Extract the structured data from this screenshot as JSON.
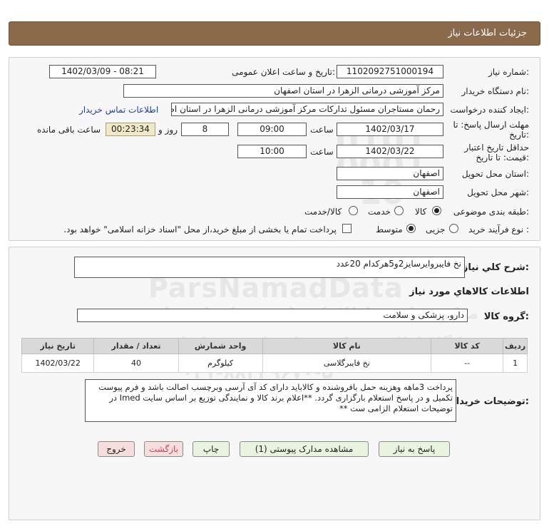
{
  "header": {
    "title": "جزئیات اطلاعات نیاز"
  },
  "form": {
    "need_number_label": "شماره نیاز:",
    "need_number": "1102092751000194",
    "announce_label": "تاریخ و ساعت اعلان عمومی:",
    "announce_value": "1402/03/09 - 08:21",
    "buyer_label": "نام دستگاه خریدار:",
    "buyer_value": "مرکز آموزشی درمانی الزهرا در استان اصفهان",
    "creator_label": "ایجاد کننده درخواست:",
    "creator_value": "رحمان مستاجران مسئول تدارکات مرکز آموزشی درمانی الزهرا در استان اصفهان",
    "contact_link": "اطلاعات تماس خریدار",
    "deadline_label_1": "مهلت ارسال پاسخ: تا",
    "deadline_label_2": "تاریخ:",
    "deadline_date": "1402/03/17",
    "time_label": "ساعت",
    "deadline_time": "09:00",
    "days_value": "8",
    "days_label": "روز و",
    "remaining_value": "00:23:34",
    "remaining_label": "ساعت باقی مانده",
    "validity_label_1": "حداقل تاریخ اعتبار",
    "validity_label_2": "قیمت: تا تاریخ:",
    "validity_date": "1402/03/22",
    "validity_time": "10:00",
    "province_label": "استان محل تحویل:",
    "province_value": "اصفهان",
    "city_label": "شهر محل تحویل:",
    "city_value": "اصفهان",
    "category_label": "طبقه بندی موضوعی:",
    "category_options": [
      "کالا",
      "خدمت",
      "کالا/خدمت"
    ],
    "category_selected": "کالا",
    "process_label": "نوع فرآیند خرید :",
    "process_options": [
      "جزیی",
      "متوسط"
    ],
    "process_selected": "متوسط",
    "payment_text": "پرداخت تمام یا بخشی از مبلغ خرید،از محل \"اسناد خزانه اسلامی\" خواهد بود."
  },
  "details": {
    "summary_label": "شرح کلي نياز:",
    "summary_value": "نخ فایبروایرسایز2و5هرکدام 20عدد",
    "goods_info_title": "اطلاعات کالاهاي مورد نياز",
    "goods_group_label": "گروه کالا:",
    "goods_group_value": "دارو، پزشکی و سلامت",
    "table": {
      "headers": [
        "ردیف",
        "کد کالا",
        "نام کالا",
        "واحد شمارش",
        "تعداد / مقدار",
        "تاریخ نیاز"
      ],
      "rows": [
        [
          "1",
          "--",
          "نخ فایبرگلاسی",
          "کیلوگرم",
          "40",
          "1402/03/22"
        ]
      ]
    },
    "buyer_notes_label": "توضیحات خریدار:",
    "buyer_notes": "پرداخت 3ماهه وهزینه حمل بافروشنده و کالاباید دارای کد آی آرسی وبرچسب اصالت باشد و فرم پیوست تکمیل و در پاسخ استعلام بارگزاری گردد. **اعلام برند کالا و نمایندگی توزیع بر اساس سایت Imed در توضیحات استعلام الزامی ست **"
  },
  "buttons": {
    "reply": "پاسخ به نیاز",
    "attachments": "مشاهده مدارک پیوستی (1)",
    "print": "چاپ",
    "back": "بازگشت",
    "exit": "خروج"
  },
  "watermark": {
    "brand": "ParsNamadData",
    "line1": "مرکز فراوری اطلاعات پارس نماد داده ها",
    "line2": "پایگاه اطلاع رسانی مناقصات و مزایدات",
    "phone": "۰۲۱-۸۸۳۴۹۶۷۰-۵",
    "digits_a": "0101",
    "digits_b": "0001",
    "digits_c": "10"
  }
}
